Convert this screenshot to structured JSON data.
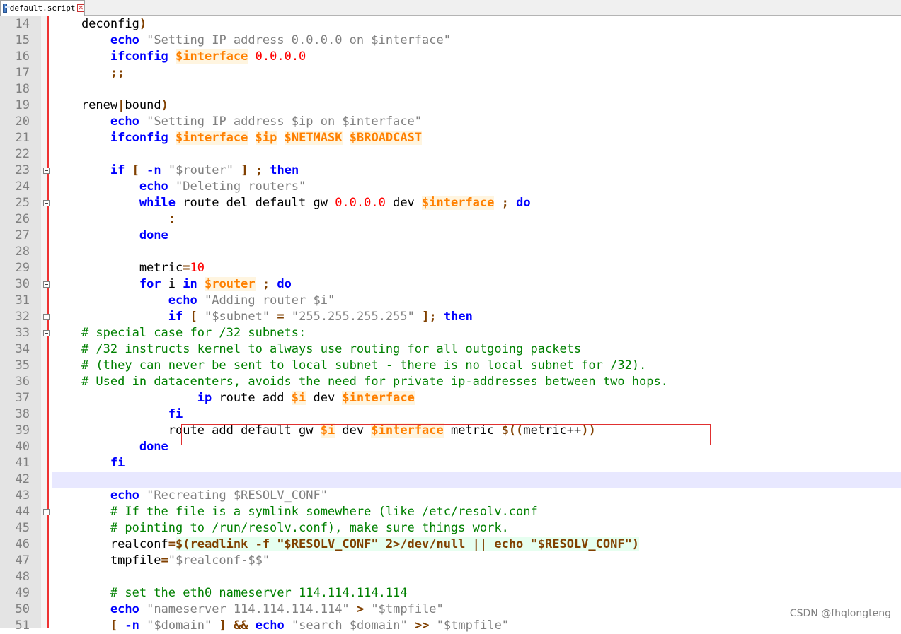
{
  "tab": {
    "filename": "default.script"
  },
  "watermark": "CSDN @fhqlongteng",
  "lines": [
    {
      "n": "14",
      "fold": false,
      "tokens": [
        [
          "",
          "    deconfig"
        ],
        [
          "op",
          ")"
        ]
      ]
    },
    {
      "n": "15",
      "fold": false,
      "tokens": [
        [
          "",
          "        "
        ],
        [
          "kw",
          "echo"
        ],
        [
          "",
          " "
        ],
        [
          "str",
          "\"Setting IP address 0.0.0.0 on $interface\""
        ]
      ]
    },
    {
      "n": "16",
      "fold": false,
      "tokens": [
        [
          "",
          "        "
        ],
        [
          "kw",
          "ifconfig"
        ],
        [
          "",
          " "
        ],
        [
          "var",
          "$interface"
        ],
        [
          "",
          " "
        ],
        [
          "num",
          "0.0.0.0"
        ]
      ]
    },
    {
      "n": "17",
      "fold": false,
      "tokens": [
        [
          "",
          "        "
        ],
        [
          "op",
          ";;"
        ]
      ]
    },
    {
      "n": "18",
      "fold": false,
      "tokens": []
    },
    {
      "n": "19",
      "fold": false,
      "tokens": [
        [
          "",
          "    renew"
        ],
        [
          "op",
          "|"
        ],
        [
          "",
          "bound"
        ],
        [
          "op",
          ")"
        ]
      ]
    },
    {
      "n": "20",
      "fold": false,
      "tokens": [
        [
          "",
          "        "
        ],
        [
          "kw",
          "echo"
        ],
        [
          "",
          " "
        ],
        [
          "str",
          "\"Setting IP address $ip on $interface\""
        ]
      ]
    },
    {
      "n": "21",
      "fold": false,
      "tokens": [
        [
          "",
          "        "
        ],
        [
          "kw",
          "ifconfig"
        ],
        [
          "",
          " "
        ],
        [
          "var",
          "$interface"
        ],
        [
          "",
          " "
        ],
        [
          "var",
          "$ip"
        ],
        [
          "",
          " "
        ],
        [
          "var",
          "$NETMASK"
        ],
        [
          "",
          " "
        ],
        [
          "var",
          "$BROADCAST"
        ]
      ]
    },
    {
      "n": "22",
      "fold": false,
      "tokens": []
    },
    {
      "n": "23",
      "fold": true,
      "tokens": [
        [
          "",
          "        "
        ],
        [
          "kw",
          "if"
        ],
        [
          "",
          " "
        ],
        [
          "op",
          "["
        ],
        [
          "",
          " "
        ],
        [
          "kw",
          "-n"
        ],
        [
          "",
          " "
        ],
        [
          "str",
          "\"$router\""
        ],
        [
          "",
          " "
        ],
        [
          "op",
          "]"
        ],
        [
          "",
          " "
        ],
        [
          "op",
          ";"
        ],
        [
          "",
          " "
        ],
        [
          "kw",
          "then"
        ]
      ]
    },
    {
      "n": "24",
      "fold": false,
      "tokens": [
        [
          "",
          "            "
        ],
        [
          "kw",
          "echo"
        ],
        [
          "",
          " "
        ],
        [
          "str",
          "\"Deleting routers\""
        ]
      ]
    },
    {
      "n": "25",
      "fold": true,
      "tokens": [
        [
          "",
          "            "
        ],
        [
          "kw",
          "while"
        ],
        [
          "",
          " route del default gw "
        ],
        [
          "num",
          "0.0.0.0"
        ],
        [
          "",
          " dev "
        ],
        [
          "var",
          "$interface"
        ],
        [
          "",
          " "
        ],
        [
          "op",
          ";"
        ],
        [
          "",
          " "
        ],
        [
          "kw",
          "do"
        ]
      ]
    },
    {
      "n": "26",
      "fold": false,
      "tokens": [
        [
          "",
          "                "
        ],
        [
          "op",
          ":"
        ]
      ]
    },
    {
      "n": "27",
      "fold": false,
      "tokens": [
        [
          "",
          "            "
        ],
        [
          "kw",
          "done"
        ]
      ]
    },
    {
      "n": "28",
      "fold": false,
      "tokens": []
    },
    {
      "n": "29",
      "fold": false,
      "tokens": [
        [
          "",
          "            metric"
        ],
        [
          "op",
          "="
        ],
        [
          "num",
          "10"
        ]
      ]
    },
    {
      "n": "30",
      "fold": true,
      "tokens": [
        [
          "",
          "            "
        ],
        [
          "kw",
          "for"
        ],
        [
          "",
          " i "
        ],
        [
          "kw",
          "in"
        ],
        [
          "",
          " "
        ],
        [
          "var",
          "$router"
        ],
        [
          "",
          " "
        ],
        [
          "op",
          ";"
        ],
        [
          "",
          " "
        ],
        [
          "kw",
          "do"
        ]
      ]
    },
    {
      "n": "31",
      "fold": false,
      "tokens": [
        [
          "",
          "                "
        ],
        [
          "kw",
          "echo"
        ],
        [
          "",
          " "
        ],
        [
          "str",
          "\"Adding router $i\""
        ]
      ]
    },
    {
      "n": "32",
      "fold": true,
      "tokens": [
        [
          "",
          "                "
        ],
        [
          "kw",
          "if"
        ],
        [
          "",
          " "
        ],
        [
          "op",
          "["
        ],
        [
          "",
          " "
        ],
        [
          "str",
          "\"$subnet\""
        ],
        [
          "",
          " "
        ],
        [
          "op",
          "="
        ],
        [
          "",
          " "
        ],
        [
          "str",
          "\"255.255.255.255\""
        ],
        [
          "",
          " "
        ],
        [
          "op",
          "];"
        ],
        [
          "",
          " "
        ],
        [
          "kw",
          "then"
        ]
      ]
    },
    {
      "n": "33",
      "fold": true,
      "tokens": [
        [
          "",
          "    "
        ],
        [
          "cmt",
          "# special case for /32 subnets:"
        ]
      ]
    },
    {
      "n": "34",
      "fold": false,
      "tokens": [
        [
          "",
          "    "
        ],
        [
          "cmt",
          "# /32 instructs kernel to always use routing for all outgoing packets"
        ]
      ]
    },
    {
      "n": "35",
      "fold": false,
      "tokens": [
        [
          "",
          "    "
        ],
        [
          "cmt",
          "# (they can never be sent to local subnet - there is no local subnet for /32)."
        ]
      ]
    },
    {
      "n": "36",
      "fold": false,
      "tokens": [
        [
          "",
          "    "
        ],
        [
          "cmt",
          "# Used in datacenters, avoids the need for private ip-addresses between two hops."
        ]
      ]
    },
    {
      "n": "37",
      "fold": false,
      "tokens": [
        [
          "",
          "                    "
        ],
        [
          "kw",
          "ip"
        ],
        [
          "",
          " route add "
        ],
        [
          "var",
          "$i"
        ],
        [
          "",
          " dev "
        ],
        [
          "var",
          "$interface"
        ]
      ]
    },
    {
      "n": "38",
      "fold": false,
      "tokens": [
        [
          "",
          "                "
        ],
        [
          "kw",
          "fi"
        ]
      ]
    },
    {
      "n": "39",
      "fold": false,
      "tokens": [
        [
          "",
          "                route add default gw "
        ],
        [
          "var",
          "$i"
        ],
        [
          "",
          " dev "
        ],
        [
          "var",
          "$interface"
        ],
        [
          "",
          " metric "
        ],
        [
          "op",
          "$(("
        ],
        [
          "",
          "metric++"
        ],
        [
          "op",
          "))"
        ]
      ]
    },
    {
      "n": "40",
      "fold": false,
      "tokens": [
        [
          "",
          "            "
        ],
        [
          "kw",
          "done"
        ]
      ]
    },
    {
      "n": "41",
      "fold": false,
      "tokens": [
        [
          "",
          "        "
        ],
        [
          "kw",
          "fi"
        ]
      ]
    },
    {
      "n": "42",
      "fold": false,
      "tokens": []
    },
    {
      "n": "43",
      "fold": false,
      "tokens": [
        [
          "",
          "        "
        ],
        [
          "kw",
          "echo"
        ],
        [
          "",
          " "
        ],
        [
          "str",
          "\"Recreating $RESOLV_CONF\""
        ]
      ]
    },
    {
      "n": "44",
      "fold": true,
      "tokens": [
        [
          "",
          "        "
        ],
        [
          "cmt",
          "# If the file is a symlink somewhere (like /etc/resolv.conf"
        ]
      ]
    },
    {
      "n": "45",
      "fold": false,
      "tokens": [
        [
          "",
          "        "
        ],
        [
          "cmt",
          "# pointing to /run/resolv.conf), make sure things work."
        ]
      ]
    },
    {
      "n": "46",
      "fold": false,
      "tokens": [
        [
          "",
          "        realconf"
        ],
        [
          "op",
          "="
        ],
        [
          "op sub",
          "$(readlink -f \"$RESOLV_CONF\" 2>/dev/null || echo \"$RESOLV_CONF\")"
        ]
      ]
    },
    {
      "n": "47",
      "fold": false,
      "tokens": [
        [
          "",
          "        tmpfile"
        ],
        [
          "op",
          "="
        ],
        [
          "str",
          "\"$realconf-$$\""
        ]
      ]
    },
    {
      "n": "48",
      "fold": false,
      "tokens": []
    },
    {
      "n": "49",
      "fold": false,
      "tokens": [
        [
          "",
          "        "
        ],
        [
          "cmt",
          "# set the eth0 nameserver 114.114.114.114"
        ]
      ]
    },
    {
      "n": "50",
      "fold": false,
      "tokens": [
        [
          "",
          "        "
        ],
        [
          "kw",
          "echo"
        ],
        [
          "",
          " "
        ],
        [
          "str",
          "\"nameserver 114.114.114.114\""
        ],
        [
          "",
          " "
        ],
        [
          "op",
          ">"
        ],
        [
          "",
          " "
        ],
        [
          "str",
          "\"$tmpfile\""
        ]
      ]
    },
    {
      "n": "51",
      "fold": false,
      "tokens": [
        [
          "",
          "        "
        ],
        [
          "op",
          "["
        ],
        [
          "",
          " "
        ],
        [
          "kw",
          "-n"
        ],
        [
          "",
          " "
        ],
        [
          "str",
          "\"$domain\""
        ],
        [
          "",
          " "
        ],
        [
          "op",
          "]"
        ],
        [
          "",
          " "
        ],
        [
          "op",
          "&&"
        ],
        [
          "",
          " "
        ],
        [
          "kw",
          "echo"
        ],
        [
          "",
          " "
        ],
        [
          "str",
          "\"search $domain\""
        ],
        [
          "",
          " "
        ],
        [
          "op",
          ">>"
        ],
        [
          "",
          " "
        ],
        [
          "str",
          "\"$tmpfile\""
        ]
      ]
    }
  ]
}
